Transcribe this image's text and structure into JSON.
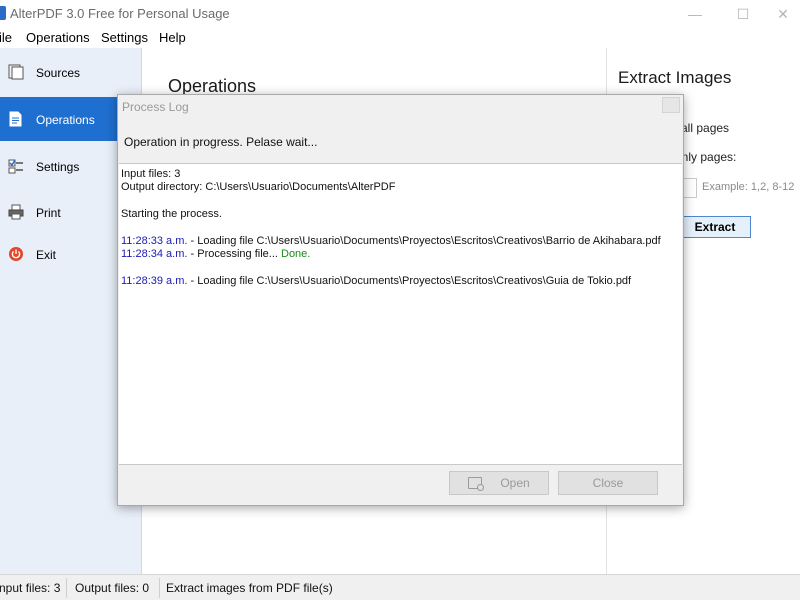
{
  "window": {
    "title": "AlterPDF 3.0 Free for Personal Usage",
    "min_glyph": "—",
    "max_glyph": "☐",
    "close_glyph": "✕"
  },
  "menu": {
    "file": "ile",
    "operations": "Operations",
    "settings": "Settings",
    "help": "Help"
  },
  "sidebar": {
    "items": [
      {
        "label": "Sources",
        "icon": "sources-icon"
      },
      {
        "label": "Operations",
        "icon": "operations-icon",
        "active": true
      },
      {
        "label": "Settings",
        "icon": "settings-icon"
      },
      {
        "label": "Print",
        "icon": "print-icon"
      },
      {
        "label": "Exit",
        "icon": "exit-icon"
      }
    ]
  },
  "main": {
    "heading": "Operations"
  },
  "right": {
    "heading": "Extract Images",
    "option_all": "all pages",
    "option_only": "only pages:",
    "example": "Example: 1,2, 8-12",
    "extract_label": "Extract"
  },
  "dialog": {
    "title": "Process Log",
    "message": "Operation in progress. Pelase wait...",
    "log": {
      "input_files": "Input files: 3",
      "output_dir": "Output directory: C:\\Users\\Usuario\\Documents\\AlterPDF",
      "starting": "Starting the process.",
      "entries": [
        {
          "time": "11:28:33 a.m.",
          "text": " - Loading file C:\\Users\\Usuario\\Documents\\Proyectos\\Escritos\\Creativos\\Barrio de Akihabara.pdf",
          "status": ""
        },
        {
          "time": "11:28:34 a.m.",
          "text": " - Processing file... ",
          "status": "Done."
        },
        {
          "time": "11:28:39 a.m.",
          "text": " - Loading file C:\\Users\\Usuario\\Documents\\Proyectos\\Escritos\\Creativos\\Guia de Tokio.pdf",
          "status": ""
        }
      ]
    },
    "open_label": "Open",
    "close_label": "Close"
  },
  "status": {
    "input_files": "nput files: 3",
    "output_files": "Output files: 0",
    "description": "Extract images from PDF file(s)"
  },
  "colors": {
    "accent": "#1f6fd0",
    "log_time": "#1a1ab4",
    "log_done": "#1a8a1a"
  }
}
